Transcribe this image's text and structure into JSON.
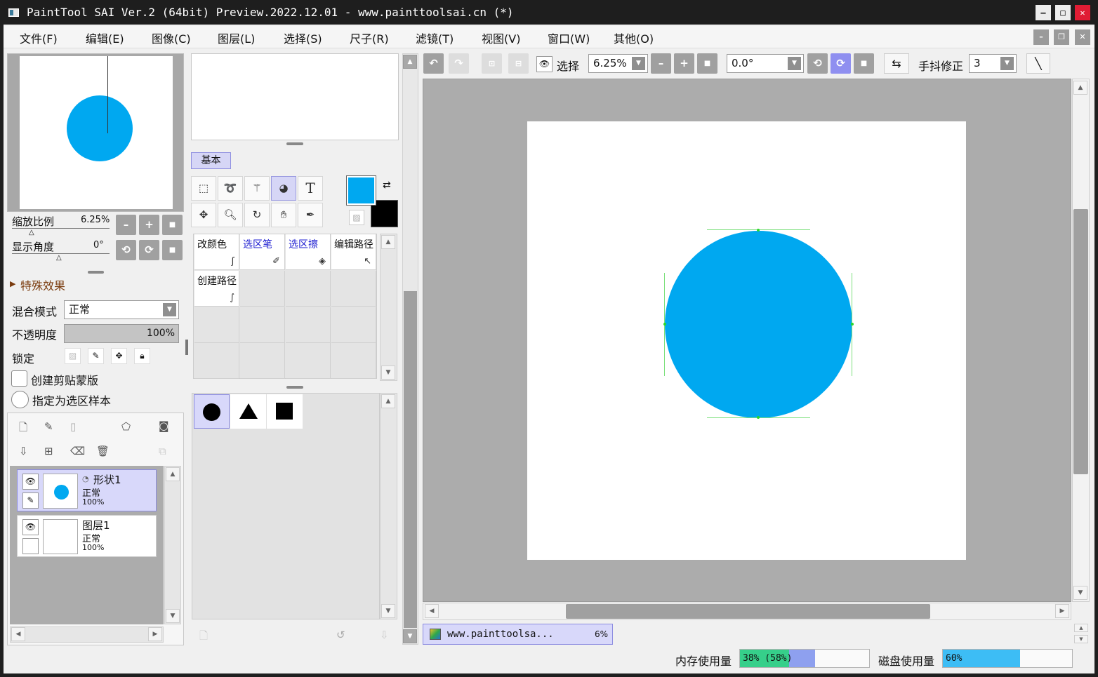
{
  "window": {
    "title": "PaintTool SAI Ver.2 (64bit) Preview.2022.12.01 - www.painttoolsai.cn (*)",
    "minimize": "–",
    "maximize": "□",
    "close": "✕"
  },
  "menu": [
    "文件(F)",
    "编辑(E)",
    "图像(C)",
    "图层(L)",
    "选择(S)",
    "尺子(R)",
    "滤镜(T)",
    "视图(V)",
    "窗口(W)",
    "其他(O)"
  ],
  "navigator": {
    "zoom_label": "缩放比例",
    "zoom_value": "6.25%",
    "angle_label": "显示角度",
    "angle_value": "0°"
  },
  "layer_props": {
    "effects_label": "特殊效果",
    "blend_label": "混合模式",
    "blend_value": "正常",
    "opacity_label": "不透明度",
    "opacity_value": "100%",
    "lock_label": "锁定",
    "clip_label": "创建剪贴蒙版",
    "sample_label": "指定为选区样本"
  },
  "layers": [
    {
      "name": "形状1",
      "mode": "正常",
      "opacity": "100%",
      "selected": true
    },
    {
      "name": "图层1",
      "mode": "正常",
      "opacity": "100%",
      "selected": false
    }
  ],
  "tools": {
    "tab_basic": "基本",
    "text_tool_glyph": "T",
    "primary_color": "#00a8f0",
    "secondary_color": "#000000",
    "brush_grid": [
      {
        "label": "改颜色",
        "color": "#111111"
      },
      {
        "label": "选区笔",
        "color": "#1a1ad0"
      },
      {
        "label": "选区擦",
        "color": "#1a1ad0"
      },
      {
        "label": "编辑路径",
        "color": "#111111"
      },
      {
        "label": "创建路径",
        "color": "#111111"
      }
    ]
  },
  "canvas_toolbar": {
    "select_label": "选择",
    "zoom_value": "6.25%",
    "angle_value": "0.0°",
    "stabilizer_label": "手抖修正",
    "stabilizer_value": "3"
  },
  "canvas": {
    "shape_color": "#00a8f0",
    "tab_title": "www.painttoolsa...",
    "tab_zoom": "6%"
  },
  "status": {
    "memory_label": "内存使用量",
    "memory_value": "38% (58%)",
    "memory_fraction": 0.38,
    "memory_peak_fraction": 0.58,
    "disk_label": "磁盘使用量",
    "disk_value": "60%",
    "disk_fraction": 0.6
  }
}
